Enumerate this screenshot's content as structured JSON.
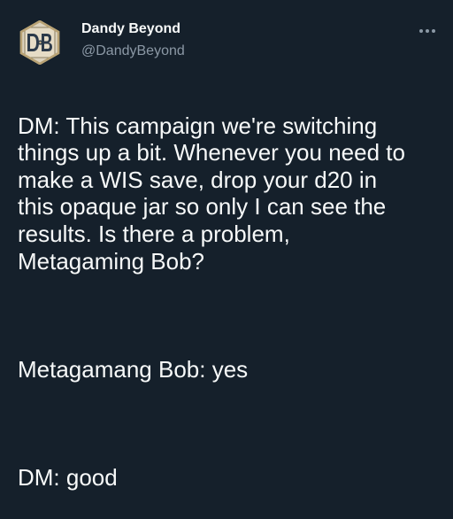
{
  "author": {
    "display_name": "Dandy Beyond",
    "handle": "@DandyBeyond",
    "avatar_icon": "dandy-beyond-db-shield-logo",
    "avatar_lettering": "DB"
  },
  "tweet": {
    "paragraph_1": "DM: This campaign we're switching\nthings up a bit. Whenever you need to\nmake a WIS save, drop your d20 in\nthis opaque jar so only I can see the\nresults. Is there a problem,\nMetagaming Bob?",
    "paragraph_2": "Metagamang Bob: yes",
    "paragraph_3": "DM: good"
  },
  "more_menu": {
    "icon": "more-horizontal-icon"
  },
  "colors": {
    "background": "#15202b",
    "text": "#f7f9f9",
    "secondary_text": "#8b98a5",
    "avatar_frame": "#c9b58a"
  }
}
